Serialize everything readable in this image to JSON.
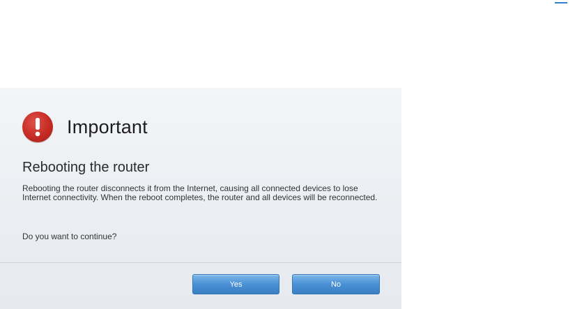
{
  "dialog": {
    "icon": "exclamation-circle-icon",
    "title": "Important",
    "heading": "Rebooting the router",
    "message": "Rebooting the router disconnects it from the Internet, causing all connected devices to lose Internet connectivity. When the reboot completes, the router and all devices will be reconnected.",
    "question": "Do you want to continue?",
    "yes_label": "Yes",
    "no_label": "No"
  },
  "colors": {
    "alert": "#c42b24",
    "button": "#4a90d4",
    "accent_line": "#2f7fd0"
  }
}
